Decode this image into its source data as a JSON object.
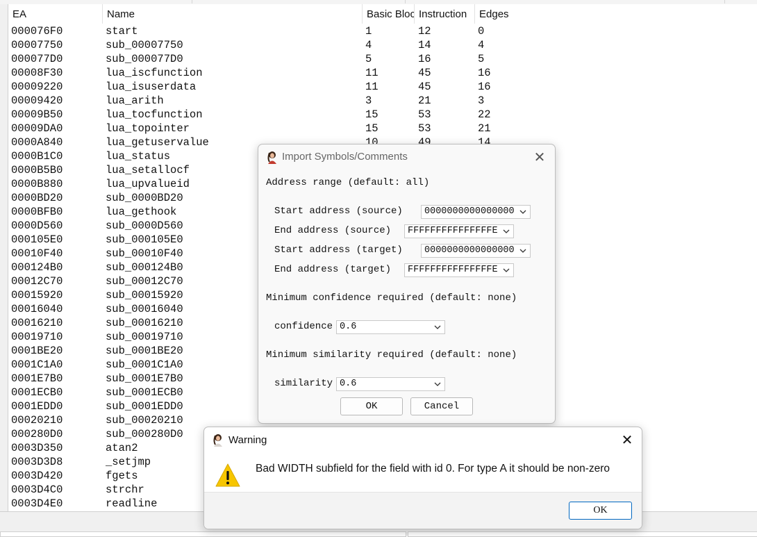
{
  "list": {
    "columns": [
      "EA",
      "Name",
      "Basic Bloc",
      "Instruction",
      "Edges"
    ],
    "rows": [
      [
        "000076F0",
        "start",
        "1",
        "12",
        "0"
      ],
      [
        "00007750",
        "sub_00007750",
        "4",
        "14",
        "4"
      ],
      [
        "000077D0",
        "sub_000077D0",
        "5",
        "16",
        "5"
      ],
      [
        "00008F30",
        "lua_iscfunction",
        "11",
        "45",
        "16"
      ],
      [
        "00009220",
        "lua_isuserdata",
        "11",
        "45",
        "16"
      ],
      [
        "00009420",
        "lua_arith",
        "3",
        "21",
        "3"
      ],
      [
        "00009B50",
        "lua_tocfunction",
        "15",
        "53",
        "22"
      ],
      [
        "00009DA0",
        "lua_topointer",
        "15",
        "53",
        "21"
      ],
      [
        "0000A840",
        "lua_getuservalue",
        "10",
        "49",
        "14"
      ],
      [
        "0000B1C0",
        "lua_status",
        "",
        "",
        ""
      ],
      [
        "0000B5B0",
        "lua_setallocf",
        "",
        "",
        ""
      ],
      [
        "0000B880",
        "lua_upvalueid",
        "",
        "",
        ""
      ],
      [
        "0000BD20",
        "sub_0000BD20",
        "",
        "",
        ""
      ],
      [
        "0000BFB0",
        "lua_gethook",
        "",
        "",
        ""
      ],
      [
        "0000D560",
        "sub_0000D560",
        "",
        "",
        ""
      ],
      [
        "000105E0",
        "sub_000105E0",
        "",
        "",
        ""
      ],
      [
        "00010F40",
        "sub_00010F40",
        "",
        "",
        ""
      ],
      [
        "000124B0",
        "sub_000124B0",
        "",
        "",
        ""
      ],
      [
        "00012C70",
        "sub_00012C70",
        "",
        "",
        ""
      ],
      [
        "00015920",
        "sub_00015920",
        "",
        "",
        ""
      ],
      [
        "00016040",
        "sub_00016040",
        "",
        "",
        ""
      ],
      [
        "00016210",
        "sub_00016210",
        "",
        "",
        ""
      ],
      [
        "00019710",
        "sub_00019710",
        "",
        "",
        ""
      ],
      [
        "0001BE20",
        "sub_0001BE20",
        "",
        "",
        ""
      ],
      [
        "0001C1A0",
        "sub_0001C1A0",
        "",
        "",
        ""
      ],
      [
        "0001E7B0",
        "sub_0001E7B0",
        "",
        "",
        ""
      ],
      [
        "0001ECB0",
        "sub_0001ECB0",
        "",
        "",
        ""
      ],
      [
        "0001EDD0",
        "sub_0001EDD0",
        "",
        "",
        ""
      ],
      [
        "00020210",
        "sub_00020210",
        "",
        "",
        ""
      ],
      [
        "000280D0",
        "sub_000280D0",
        "",
        "",
        ""
      ],
      [
        "0003D350",
        "atan2",
        "",
        "",
        ""
      ],
      [
        "0003D3D8",
        "_setjmp",
        "",
        "",
        ""
      ],
      [
        "0003D420",
        "fgets",
        "",
        "",
        ""
      ],
      [
        "0003D4C0",
        "strchr",
        "",
        "",
        ""
      ],
      [
        "0003D4E0",
        "readline",
        "",
        "",
        ""
      ]
    ]
  },
  "import_dialog": {
    "title": "Import Symbols/Comments",
    "address_heading": "Address range (default: all)",
    "start_source_label": "Start address (source)",
    "start_source_value": "0000000000000000",
    "end_source_label": "End address (source)",
    "end_source_value": "FFFFFFFFFFFFFFFE",
    "start_target_label": "Start address (target)",
    "start_target_value": "0000000000000000",
    "end_target_label": "End address (target)",
    "end_target_value": "FFFFFFFFFFFFFFFE",
    "confidence_heading": "Minimum confidence required (default: none)",
    "confidence_label": "confidence",
    "confidence_value": "0.6",
    "similarity_heading": "Minimum similarity required (default: none)",
    "similarity_label": "similarity",
    "similarity_value": "0.6",
    "ok_label": "OK",
    "cancel_label": "Cancel"
  },
  "warning_dialog": {
    "title": "Warning",
    "message": "Bad WIDTH subfield for the field with id 0. For type A it should be non-zero",
    "ok_label": "OK",
    "icon": "warning-triangle-icon"
  },
  "colors": {
    "accent": "#0067c0",
    "warning_yellow": "#f7c600"
  }
}
